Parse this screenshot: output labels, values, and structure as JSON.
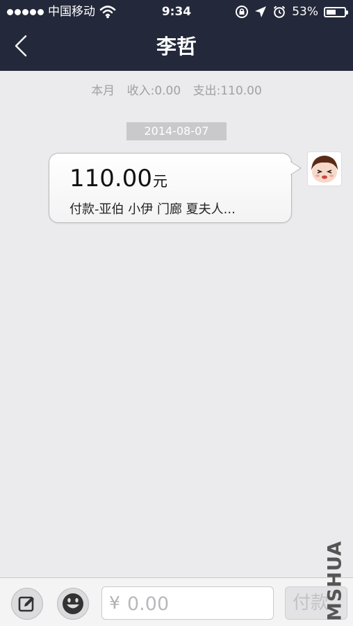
{
  "status_bar": {
    "carrier": "中国移动",
    "time": "9:34",
    "battery": "53%",
    "battery_level": 0.53
  },
  "header": {
    "title": "李哲",
    "back_icon": "chevron-left-icon"
  },
  "summary": {
    "period": "本月",
    "income": "收入:0.00",
    "expense": "支出:110.00"
  },
  "date_badge": "2014-08-07",
  "message": {
    "amount": "110.00",
    "unit": "元",
    "description": "付款-亚伯 小伊 门廊 夏夫人..."
  },
  "toolbar": {
    "currency": "¥",
    "amount_placeholder": "0.00",
    "pay_label": "付款",
    "edit_icon": "edit-icon",
    "emoji_icon": "smiley-icon"
  },
  "watermark": "MSHUA",
  "colors": {
    "header_bg": "#23283a",
    "page_bg": "#ebebed"
  }
}
